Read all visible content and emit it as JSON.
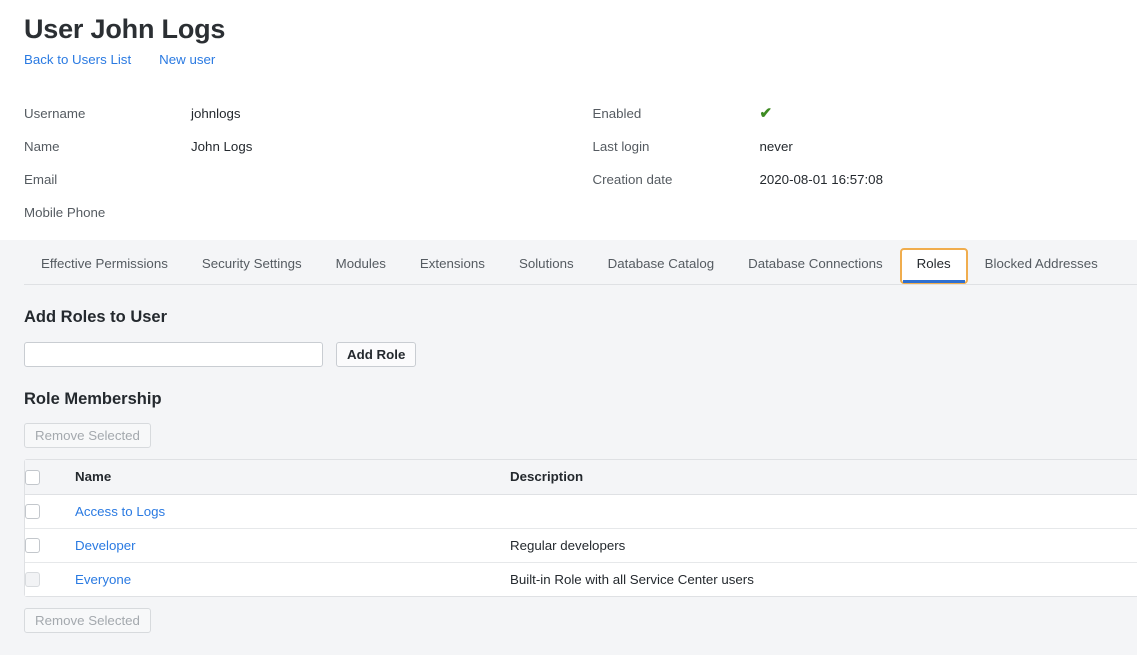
{
  "header": {
    "title": "User John Logs",
    "links": [
      {
        "label": "Back to Users List"
      },
      {
        "label": "New user"
      }
    ]
  },
  "details": {
    "left": [
      {
        "label": "Username",
        "value": "johnlogs"
      },
      {
        "label": "Name",
        "value": "John Logs"
      },
      {
        "label": "Email",
        "value": ""
      },
      {
        "label": "Mobile Phone",
        "value": ""
      }
    ],
    "right": [
      {
        "label": "Enabled",
        "value": "✔",
        "icon": "check-icon",
        "color": "#3d8b22"
      },
      {
        "label": "Last login",
        "value": "never"
      },
      {
        "label": "Creation date",
        "value": "2020-08-01 16:57:08"
      }
    ]
  },
  "tabs": {
    "active": "Roles",
    "items": [
      {
        "label": "Effective Permissions"
      },
      {
        "label": "Security Settings"
      },
      {
        "label": "Modules"
      },
      {
        "label": "Extensions"
      },
      {
        "label": "Solutions"
      },
      {
        "label": "Database Catalog"
      },
      {
        "label": "Database Connections"
      },
      {
        "label": "Roles"
      },
      {
        "label": "Blocked Addresses"
      }
    ]
  },
  "roles_tab": {
    "add_heading": "Add Roles to User",
    "add_input_value": "",
    "add_input_placeholder": "",
    "add_button": "Add Role",
    "membership_heading": "Role Membership",
    "remove_button_top": "Remove Selected",
    "remove_button_bottom": "Remove Selected",
    "table": {
      "columns": [
        "",
        "Name",
        "Description"
      ],
      "rows": [
        {
          "checked": false,
          "disabled": false,
          "name": "Access to Logs",
          "description": ""
        },
        {
          "checked": false,
          "disabled": false,
          "name": "Developer",
          "description": "Regular developers"
        },
        {
          "checked": false,
          "disabled": true,
          "name": "Everyone",
          "description": "Built-in Role with all Service Center users"
        }
      ]
    }
  },
  "colors": {
    "link": "#2a7ae2",
    "accent_focus": "#f0ad4e",
    "tab_active_underline": "#2f6fd0",
    "enabled_check": "#3d8b22",
    "panel_bg": "#f4f5f7"
  }
}
